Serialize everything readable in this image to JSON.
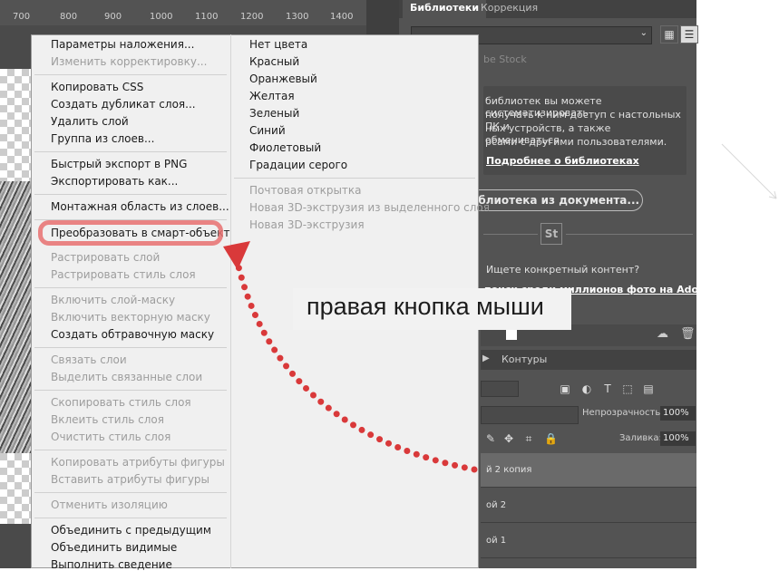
{
  "ruler": {
    "ticks": [
      "700",
      "800",
      "900",
      "1000",
      "1100",
      "1200",
      "1300",
      "1400"
    ]
  },
  "right_panel": {
    "tabs": [
      {
        "label": "Библиотеки",
        "active": true
      },
      {
        "label": "Коррекция",
        "active": false
      }
    ],
    "library_select_value": "",
    "stock_label": "be Stock",
    "info_lines": [
      "библиотек вы можете систематизировать",
      "получать к ним доступ с настольных ПК и",
      "ных устройств, а также обмениваться",
      "рсами с другими пользователями."
    ],
    "info_link": "Подробнее о библиотеках",
    "new_library_button": "иблиотека из документа...",
    "st_logo": "St",
    "search_question": "Ищете конкретный контент?",
    "search_link": "поиск среди миллионов фото на Adobe",
    "layers_tab_contours": "Контуры",
    "opacity_label": "Непрозрачность:",
    "opacity_value": "100%",
    "fill_label": "Заливка:",
    "fill_value": "100%",
    "layers": [
      "й 2 копия",
      "ой 2",
      "ой 1"
    ]
  },
  "context_menu": {
    "left_items": [
      {
        "label": "Параметры наложения...",
        "disabled": false
      },
      {
        "label": "Изменить корректировку...",
        "disabled": true
      },
      {
        "label": "Копировать CSS",
        "disabled": false
      },
      {
        "label": "Создать дубликат слоя...",
        "disabled": false
      },
      {
        "label": "Удалить слой",
        "disabled": false
      },
      {
        "label": "Группа из слоев...",
        "disabled": false
      },
      {
        "label": "Быстрый экспорт в PNG",
        "disabled": false
      },
      {
        "label": "Экспортировать как...",
        "disabled": false
      },
      {
        "label": "Монтажная область из слоев...",
        "disabled": false
      },
      {
        "label": "Преобразовать в смарт-объект",
        "disabled": false
      },
      {
        "label": "Растрировать слой",
        "disabled": true
      },
      {
        "label": "Растрировать стиль слоя",
        "disabled": true
      },
      {
        "label": "Включить слой-маску",
        "disabled": true
      },
      {
        "label": "Включить векторную маску",
        "disabled": true
      },
      {
        "label": "Создать обтравочную маску",
        "disabled": false
      },
      {
        "label": "Связать слои",
        "disabled": true
      },
      {
        "label": "Выделить связанные слои",
        "disabled": true
      },
      {
        "label": "Скопировать стиль слоя",
        "disabled": true
      },
      {
        "label": "Вклеить стиль слоя",
        "disabled": true
      },
      {
        "label": "Очистить стиль слоя",
        "disabled": true
      },
      {
        "label": "Копировать атрибуты фигуры",
        "disabled": true
      },
      {
        "label": "Вставить атрибуты фигуры",
        "disabled": true
      },
      {
        "label": "Отменить изоляцию",
        "disabled": true
      },
      {
        "label": "Объединить с предыдущим",
        "disabled": false
      },
      {
        "label": "Объединить видимые",
        "disabled": false
      },
      {
        "label": "Выполнить сведение",
        "disabled": false
      }
    ],
    "right_items": [
      {
        "label": "Нет цвета",
        "disabled": false
      },
      {
        "label": "Красный",
        "disabled": false
      },
      {
        "label": "Оранжевый",
        "disabled": false
      },
      {
        "label": "Желтая",
        "disabled": false
      },
      {
        "label": "Зеленый",
        "disabled": false
      },
      {
        "label": "Синий",
        "disabled": false
      },
      {
        "label": "Фиолетовый",
        "disabled": false
      },
      {
        "label": "Градации серого",
        "disabled": false
      },
      {
        "label": "Почтовая открытка",
        "disabled": true
      },
      {
        "label": "Новая 3D-экструзия из выделенного слоя",
        "disabled": true
      },
      {
        "label": "Новая 3D-экструзия",
        "disabled": true
      }
    ]
  },
  "annotation": {
    "callout_text": "правая кнопка мыши",
    "highlight_color": "#e87070",
    "arrow_color": "#d9393a"
  }
}
